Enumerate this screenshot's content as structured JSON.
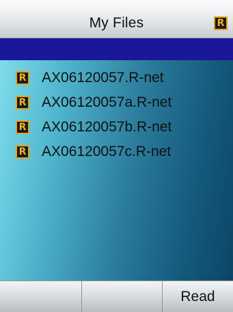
{
  "header": {
    "title": "My Files",
    "icon": "r-net-icon"
  },
  "files": [
    {
      "name": "AX06120057.R-net",
      "icon": "r-net-file-icon"
    },
    {
      "name": "AX06120057a.R-net",
      "icon": "r-net-file-icon"
    },
    {
      "name": "AX06120057b.R-net",
      "icon": "r-net-file-icon"
    },
    {
      "name": "AX06120057c.R-net",
      "icon": "r-net-file-icon"
    }
  ],
  "softkeys": {
    "left": "",
    "center": "",
    "right": "Read"
  },
  "icon_glyph": "R",
  "colors": {
    "selection_band": "#1a1898",
    "icon_border": "#e3a21a",
    "icon_background": "#1a1a1a"
  }
}
